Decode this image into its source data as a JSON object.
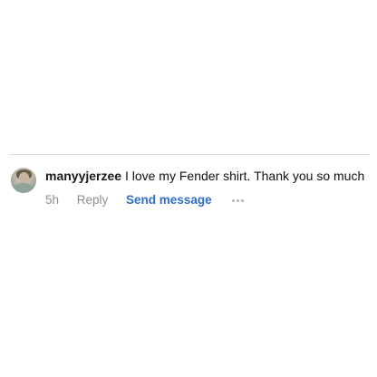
{
  "comment": {
    "username": "manyyjerzee",
    "text": "I love my Fender shirt. Thank you so much",
    "timestamp": "5h",
    "reply_label": "Reply",
    "send_message_label": "Send message",
    "more_icon": "more-horizontal-icon"
  },
  "colors": {
    "link_blue": "#2f6fcc",
    "meta_gray": "#8e8e8e",
    "divider": "#dcdcdc"
  }
}
